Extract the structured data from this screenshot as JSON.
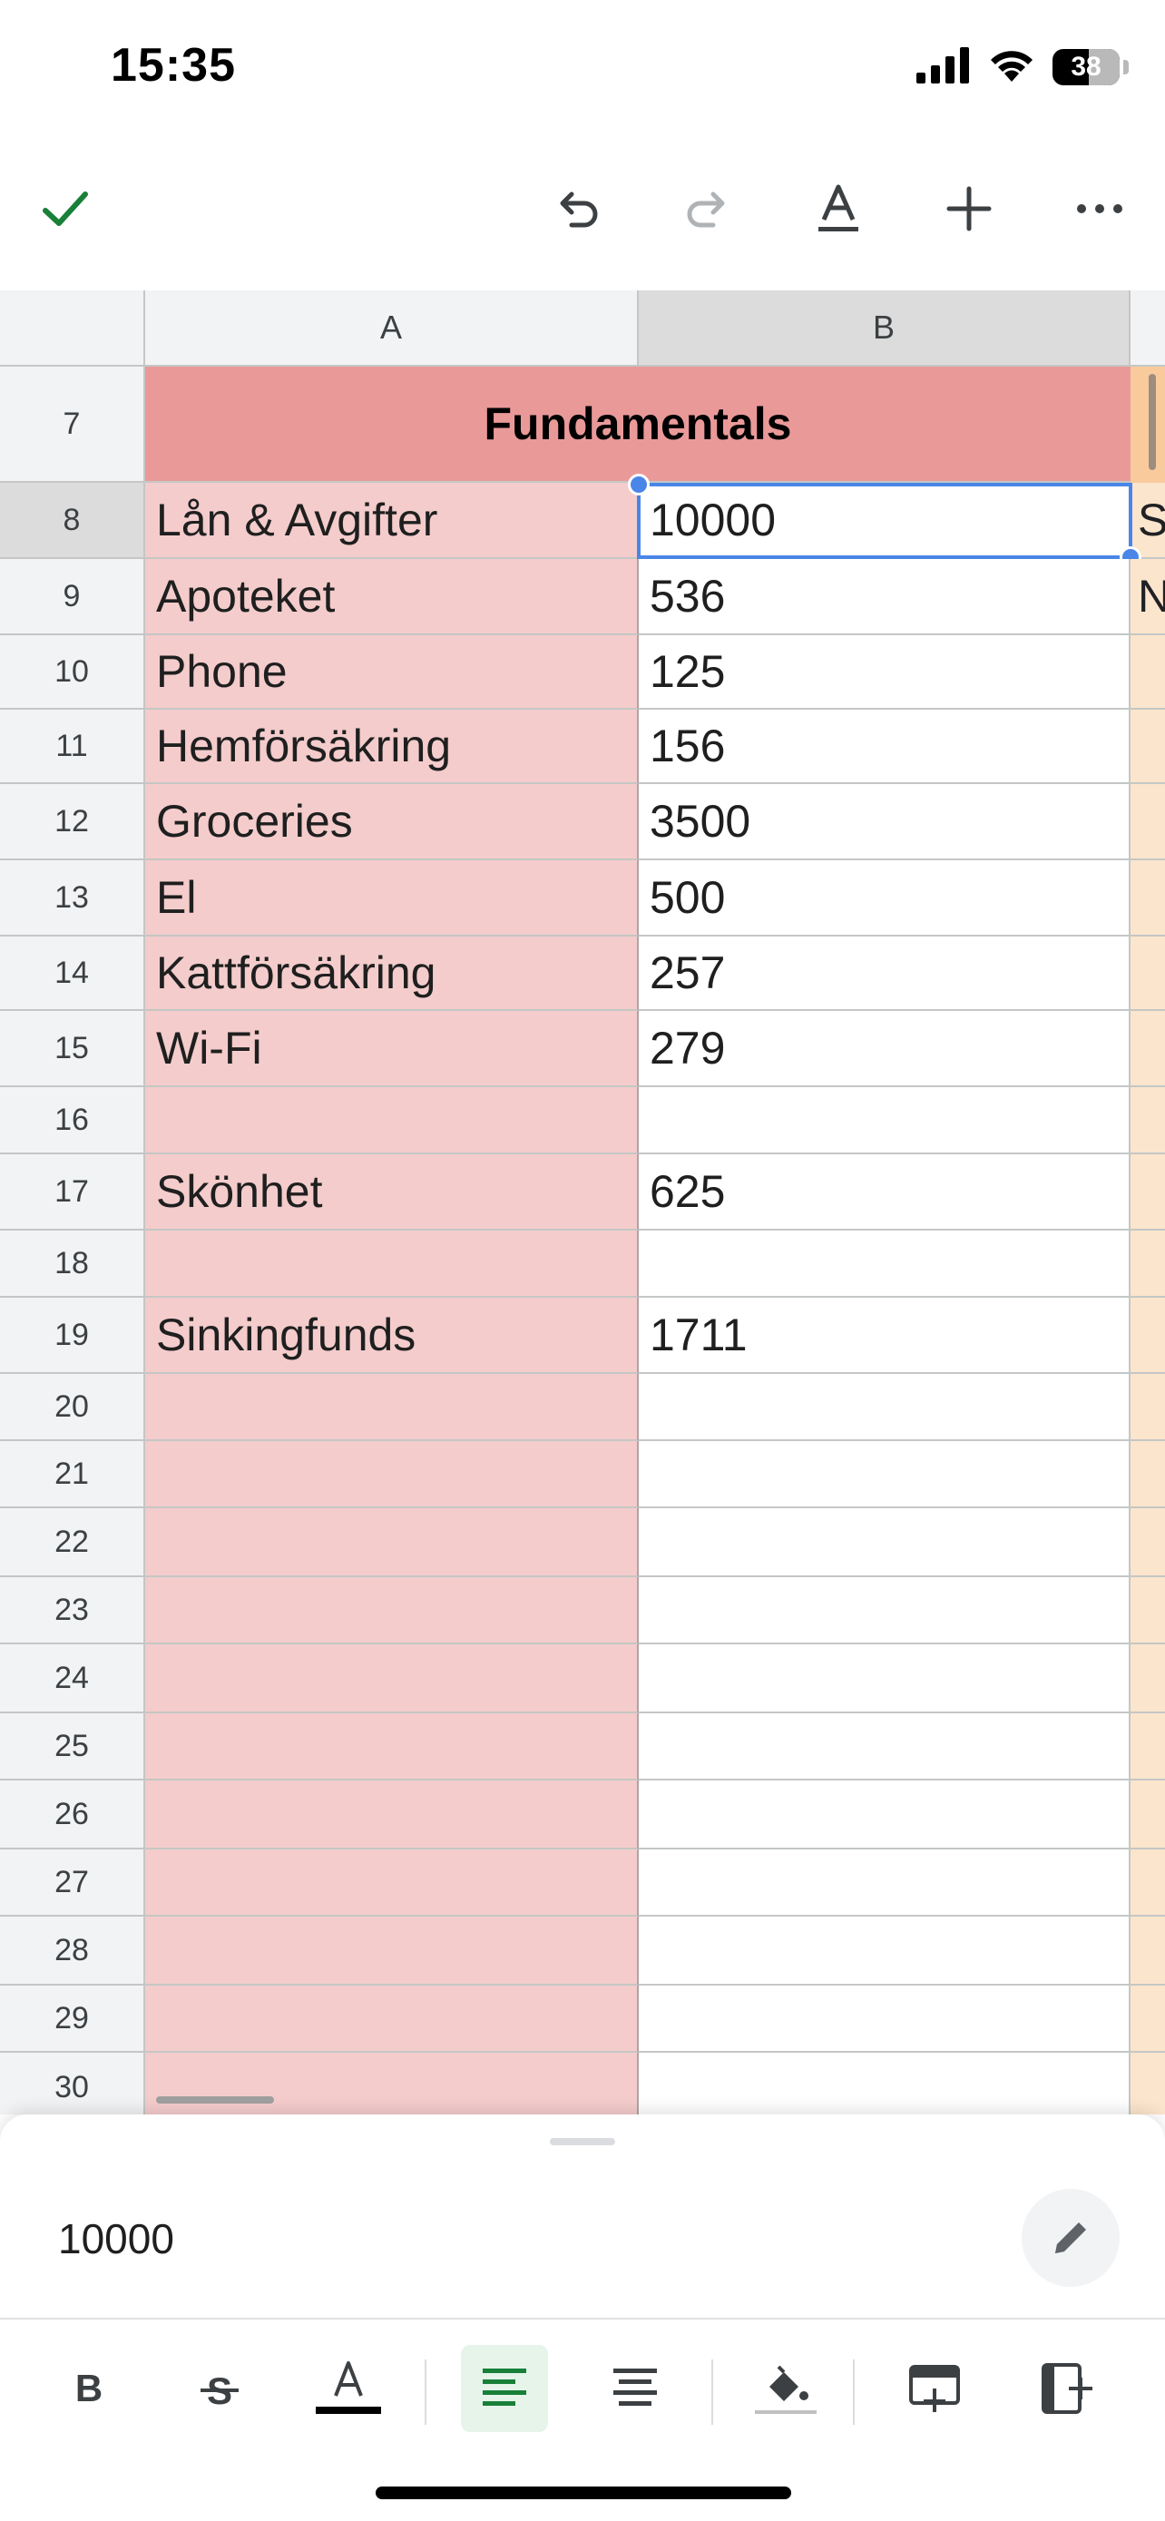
{
  "status_bar": {
    "time": "15:35",
    "battery_level": "38"
  },
  "toolbar": {
    "icons": [
      "checkmark-icon",
      "undo-icon",
      "redo-icon",
      "text-format-icon",
      "plus-icon",
      "more-icon"
    ]
  },
  "sheet": {
    "columns": [
      "A",
      "B"
    ],
    "header_row": {
      "number": "7",
      "title": "Fundamentals"
    },
    "rows": [
      {
        "number": "8",
        "a": "Lån & Avgifter",
        "b": "10000",
        "c": "S"
      },
      {
        "number": "9",
        "a": "Apoteket",
        "b": "536",
        "c": "N"
      },
      {
        "number": "10",
        "a": "Phone",
        "b": "125",
        "c": ""
      },
      {
        "number": "11",
        "a": "Hemförsäkring",
        "b": "156",
        "c": ""
      },
      {
        "number": "12",
        "a": "Groceries",
        "b": "3500",
        "c": ""
      },
      {
        "number": "13",
        "a": "El",
        "b": "500",
        "c": ""
      },
      {
        "number": "14",
        "a": "Kattförsäkring",
        "b": "257",
        "c": ""
      },
      {
        "number": "15",
        "a": "Wi-Fi",
        "b": "279",
        "c": ""
      },
      {
        "number": "16",
        "a": "",
        "b": "",
        "c": ""
      },
      {
        "number": "17",
        "a": "Skönhet",
        "b": "625",
        "c": ""
      },
      {
        "number": "18",
        "a": "",
        "b": "",
        "c": ""
      },
      {
        "number": "19",
        "a": "Sinkingfunds",
        "b": "1711",
        "c": ""
      },
      {
        "number": "20",
        "a": "",
        "b": "",
        "c": ""
      },
      {
        "number": "21",
        "a": "",
        "b": "",
        "c": ""
      },
      {
        "number": "22",
        "a": "",
        "b": "",
        "c": ""
      },
      {
        "number": "23",
        "a": "",
        "b": "",
        "c": ""
      },
      {
        "number": "24",
        "a": "",
        "b": "",
        "c": ""
      },
      {
        "number": "25",
        "a": "",
        "b": "",
        "c": ""
      },
      {
        "number": "26",
        "a": "",
        "b": "",
        "c": ""
      },
      {
        "number": "27",
        "a": "",
        "b": "",
        "c": ""
      },
      {
        "number": "28",
        "a": "",
        "b": "",
        "c": ""
      },
      {
        "number": "29",
        "a": "",
        "b": "",
        "c": ""
      },
      {
        "number": "30",
        "a": "",
        "b": "",
        "c": ""
      }
    ],
    "selected_cell": "B8"
  },
  "formula_bar": {
    "value": "10000"
  },
  "format_bar": {
    "icons": [
      "bold-icon",
      "strikethrough-icon",
      "text-color-icon",
      "align-left-icon",
      "align-center-icon",
      "fill-color-icon",
      "insert-row-icon",
      "insert-column-icon"
    ]
  },
  "colors": {
    "header_fill": "#ea9999",
    "col_a_fill": "#f4cccc",
    "col_c_fill": "#fce5cd",
    "selection": "#4a86e8",
    "confirm_green": "#188038"
  }
}
